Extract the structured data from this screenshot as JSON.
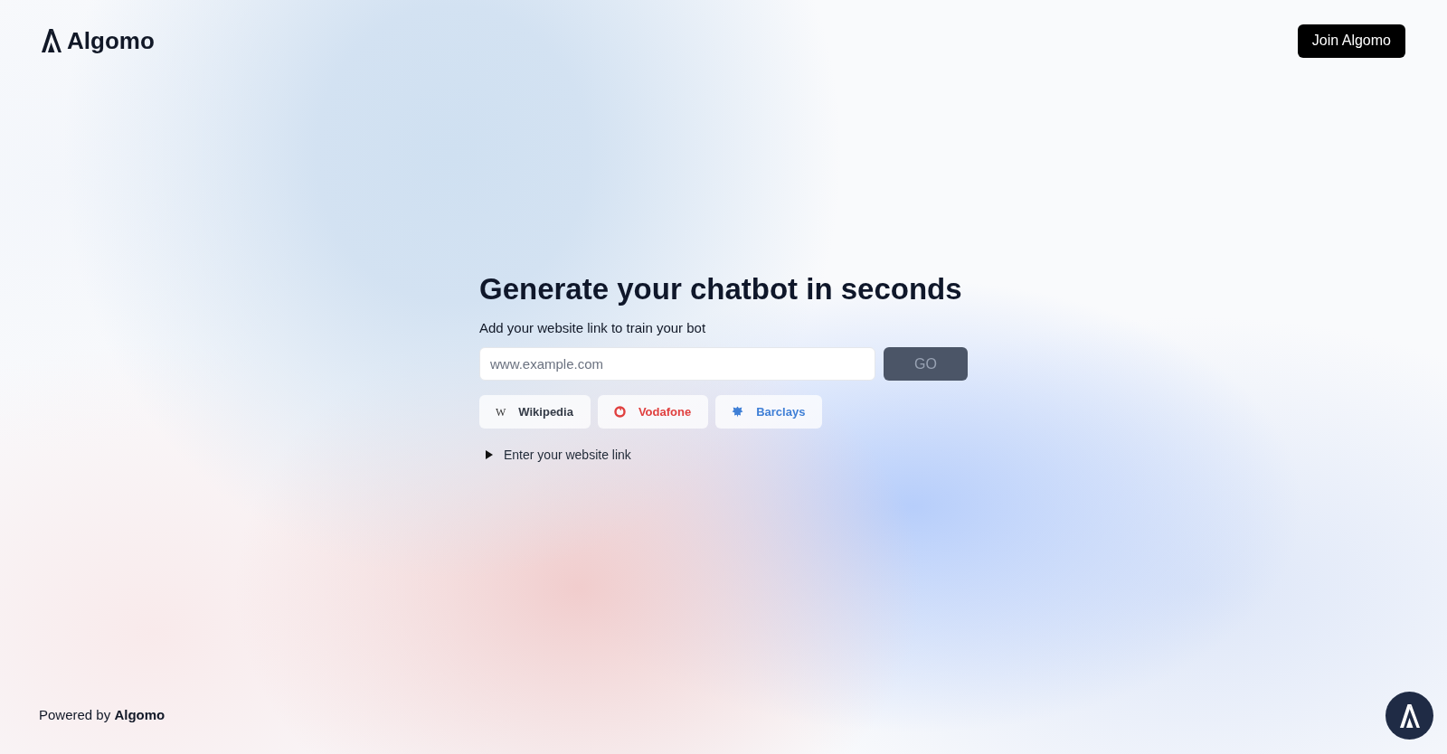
{
  "header": {
    "logo_text": "Algomo",
    "join_button": "Join Algomo"
  },
  "hero": {
    "title": "Generate your chatbot in seconds",
    "subtitle": "Add your website link to train your bot",
    "url_field": {
      "placeholder": "www.example.com"
    },
    "go_button": {
      "label": "GO",
      "disabled": true
    },
    "examples": [
      {
        "kind": "letter",
        "glyph": "W",
        "label": "Wikipedia",
        "color": "#343b47"
      },
      {
        "kind": "ring",
        "label": "Vodafone",
        "color": "#e0403f"
      },
      {
        "kind": "bird",
        "label": "Barclays",
        "color": "#3f7fd6"
      }
    ],
    "disclosure": {
      "label": "Enter your website link",
      "expanded": false
    }
  },
  "footer": {
    "powered_by": "Powered by **Algomo**"
  }
}
